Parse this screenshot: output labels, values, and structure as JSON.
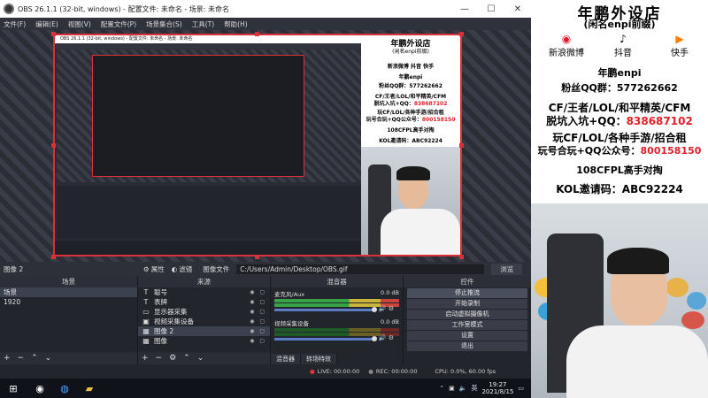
{
  "obs": {
    "title": "OBS 26.1.1 (32-bit, windows) - 配置文件: 未命名 - 场景: 未命名",
    "menu": [
      "文件(F)",
      "编辑(E)",
      "视图(V)",
      "配置文件(P)",
      "场景集合(S)",
      "工具(T)",
      "帮助(H)"
    ],
    "window_buttons": [
      "—",
      "☐",
      "✕"
    ],
    "properties_bar": {
      "label": "图像 2",
      "properties": "属性",
      "filters": "滤镜",
      "image_file_label": "图像文件",
      "path": "C:/Users/Admin/Desktop/OBS.gif",
      "browse": "浏览"
    },
    "scenes": {
      "header": "场景",
      "items": [
        "场景",
        "1920"
      ]
    },
    "sources": {
      "header": "来源",
      "items": [
        {
          "icon": "T",
          "name": "聪号"
        },
        {
          "icon": "T",
          "name": "表牌"
        },
        {
          "icon": "▭",
          "name": "显示器采集"
        },
        {
          "icon": "▣",
          "name": "视频采集设备"
        },
        {
          "icon": "▦",
          "name": "图像 2"
        },
        {
          "icon": "▦",
          "name": "图像"
        }
      ]
    },
    "mixer": {
      "header": "混音器",
      "tracks": [
        {
          "name": "麦克风/Aux",
          "db": "0.0 dB"
        },
        {
          "name": "视频采集设备",
          "db": "0.0 dB"
        }
      ],
      "tabs": [
        "混音器",
        "转场特效"
      ]
    },
    "controls": {
      "header": "控件",
      "buttons": [
        "停止推流",
        "开始录制",
        "启动虚拟摄像机",
        "工作室模式",
        "设置",
        "退出"
      ]
    },
    "status": {
      "live": "LIVE: 00:00:00",
      "rec": "REC: 00:00:00",
      "cpu": "CPU: 0.0%, 60.00 fps"
    }
  },
  "taskbar": {
    "time": "19:27",
    "date": "2021/8/15"
  },
  "poster": {
    "title": "年鹏外设店",
    "subtitle": "(闲名enpi前缀)",
    "socials": [
      {
        "icon": "weibo-icon",
        "symbol": "◉",
        "label": "新浪微博"
      },
      {
        "icon": "douyin-icon",
        "symbol": "♪",
        "label": "抖音"
      },
      {
        "icon": "kuaishou-icon",
        "symbol": "▶",
        "label": "快手"
      }
    ],
    "name_tag": "年鹏enpi",
    "fans_line_prefix": "粉丝QQ群：",
    "fans_number": "577262662",
    "line_a": "CF/王者/LOL/和平精英/CFM",
    "line_b_prefix": "脱坑入坑+QQ：",
    "line_b_number": "838687102",
    "line_c": "玩CF/LOL/各种手游/招合租",
    "line_d_prefix": "玩号合玩+QQ公众号：",
    "line_d_number": "800158150",
    "line_e": "108CFPL高手对掏",
    "line_f": "KOL邀请码：ABC92224"
  },
  "colors": {
    "accent_red": "#e0202a",
    "selection_red": "#d9303a",
    "obs_bg": "#272a33"
  }
}
